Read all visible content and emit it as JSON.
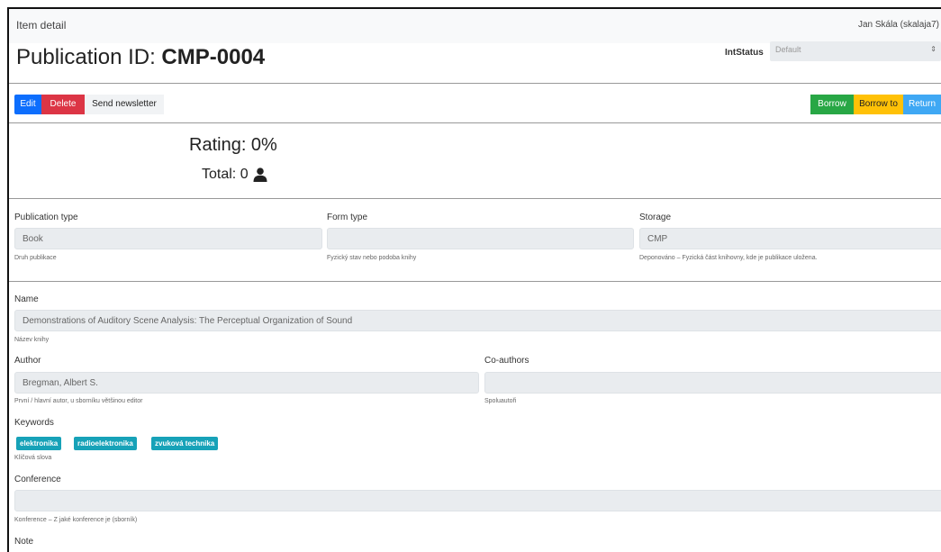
{
  "header": {
    "breadcrumb": "Item detail",
    "user": "Jan Skála (skalaja7)"
  },
  "title": {
    "prefix": "Publication ID: ",
    "id": "CMP-0004"
  },
  "int_status": {
    "label": "IntStatus",
    "value": "Default",
    "caret": "⇕"
  },
  "actions": {
    "edit": "Edit",
    "delete": "Delete",
    "send_newsletter": "Send newsletter",
    "borrow": "Borrow",
    "borrow_to": "Borrow to",
    "return": "Return"
  },
  "rating": {
    "text": "Rating: 0%",
    "total": "Total: 0",
    "icon": "user-icon"
  },
  "publication_type": {
    "label": "Publication type",
    "value": "Book",
    "help": "Druh publikace"
  },
  "form_type": {
    "label": "Form type",
    "value": "",
    "help": "Fyzický stav nebo podoba knihy"
  },
  "storage": {
    "label": "Storage",
    "value": "CMP",
    "help": "Deponováno – Fyzická část knihovny, kde je publikace uložena."
  },
  "name": {
    "label": "Name",
    "value": "Demonstrations of Auditory Scene Analysis: The Perceptual Organization of Sound",
    "help": "Název knihy"
  },
  "author": {
    "label": "Author",
    "value": "Bregman, Albert S.",
    "help": "První / hlavní autor, u sborníku většinou editor"
  },
  "coauthors": {
    "label": "Co-authors",
    "value": "",
    "help": "Spoluautoři"
  },
  "keywords": {
    "label": "Keywords",
    "items": [
      "elektronika",
      "radioelektronika",
      "zvuková technika"
    ],
    "help": "Klíčová slova"
  },
  "conference": {
    "label": "Conference",
    "value": "",
    "help": "Konference – Z jaké konference je (sborník)"
  },
  "note": {
    "label": "Note"
  },
  "colors": {
    "primary": "#0d6efd",
    "danger": "#dc3545",
    "success": "#28a745",
    "warning": "#ffc107",
    "info": "#17a2b8"
  }
}
